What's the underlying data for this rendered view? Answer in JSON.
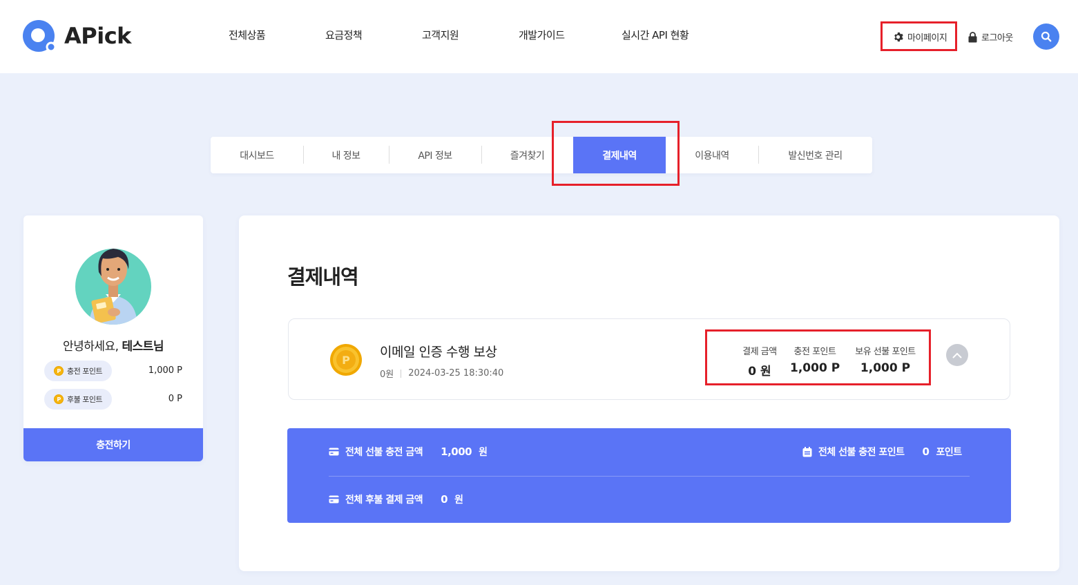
{
  "brand": {
    "name": "APick",
    "accent": "#5a74f6",
    "logo_color": "#4a82f0"
  },
  "nav": {
    "items": [
      "전체상품",
      "요금정책",
      "고객지원",
      "개발가이드",
      "실시간 API 현황"
    ]
  },
  "util": {
    "mypage": "마이페이지",
    "logout": "로그아웃",
    "search_icon": "search-icon"
  },
  "tabs": [
    "대시보드",
    "내 정보",
    "API 정보",
    "즐겨찾기",
    "결제내역",
    "이용내역",
    "발신번호 관리"
  ],
  "active_tab": "결제내역",
  "profile": {
    "greeting_prefix": "안녕하세요, ",
    "greeting_name": "테스트님",
    "charge_points_label": "충전 포인트",
    "charge_points_value": "1,000 P",
    "postpaid_points_label": "후불 포인트",
    "postpaid_points_value": "0 P",
    "coin_symbol": "P",
    "charge_button": "충전하기"
  },
  "main": {
    "title": "결제내역",
    "payment": {
      "coin_symbol": "P",
      "title": "이메일 인증 수행 보상",
      "amount": "0원",
      "datetime": "2024-03-25 18:30:40",
      "paid_label": "결제 금액",
      "paid_value": "0 원",
      "charged_label": "충전 포인트",
      "charged_value": "1,000 P",
      "holding_label": "보유 선불 포인트",
      "holding_value": "1,000 P"
    },
    "summary": {
      "prepaid_total_label": "전체 선불 충전 금액",
      "prepaid_total_value": "1,000",
      "prepaid_total_unit": "원",
      "prepaid_points_label": "전체 선불 충전 포인트",
      "prepaid_points_value": "0",
      "prepaid_points_unit": "포인트",
      "postpaid_total_label": "전체 후불 결제 금액",
      "postpaid_total_value": "0",
      "postpaid_total_unit": "원"
    }
  }
}
